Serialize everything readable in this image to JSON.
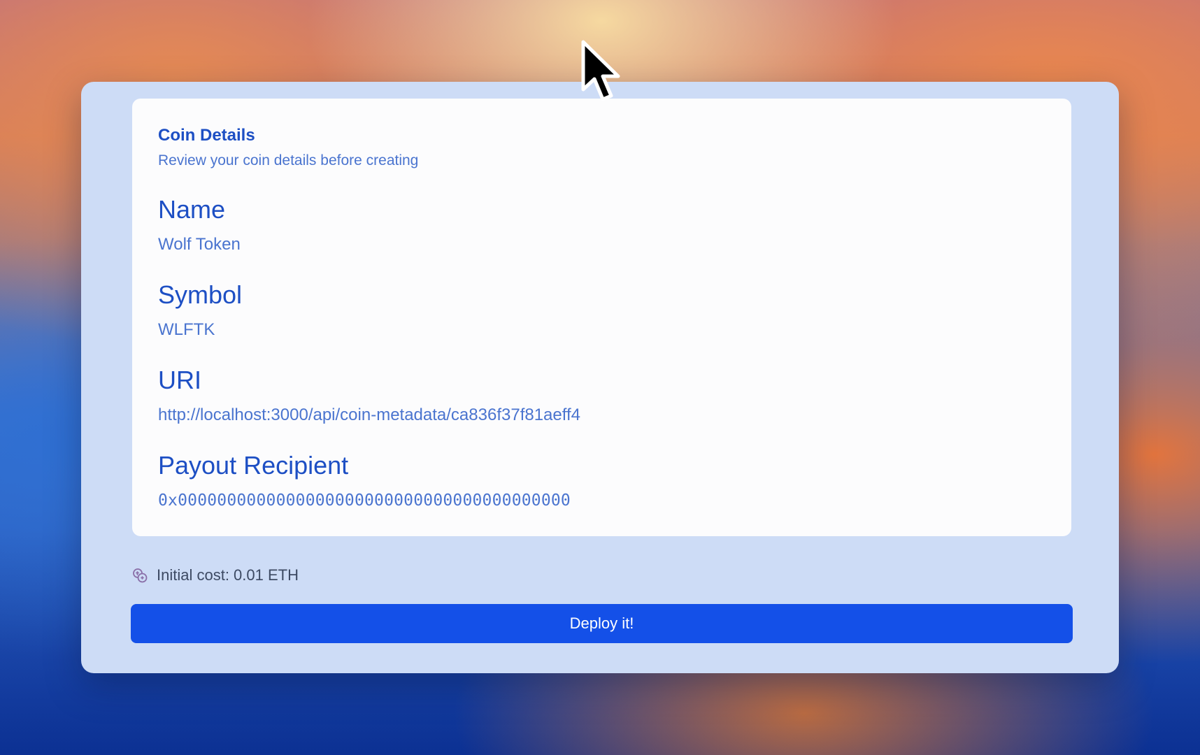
{
  "card": {
    "title": "Coin Details",
    "subtitle": "Review your coin details before creating"
  },
  "fields": [
    {
      "label": "Name",
      "value": "Wolf Token"
    },
    {
      "label": "Symbol",
      "value": "WLFTK"
    },
    {
      "label": "URI",
      "value": "http://localhost:3000/api/coin-metadata/ca836f37f81aeff4"
    },
    {
      "label": "Payout Recipient",
      "value": "0x0000000000000000000000000000000000000000"
    }
  ],
  "cost": {
    "text": "Initial cost: 0.01 ETH",
    "icon": "coins-icon"
  },
  "actions": {
    "deploy_label": "Deploy it!"
  },
  "colors": {
    "accent": "#1450e8",
    "title": "#1d4fc4",
    "value": "#4a74cf",
    "modal_bg": "#cddcf6"
  }
}
